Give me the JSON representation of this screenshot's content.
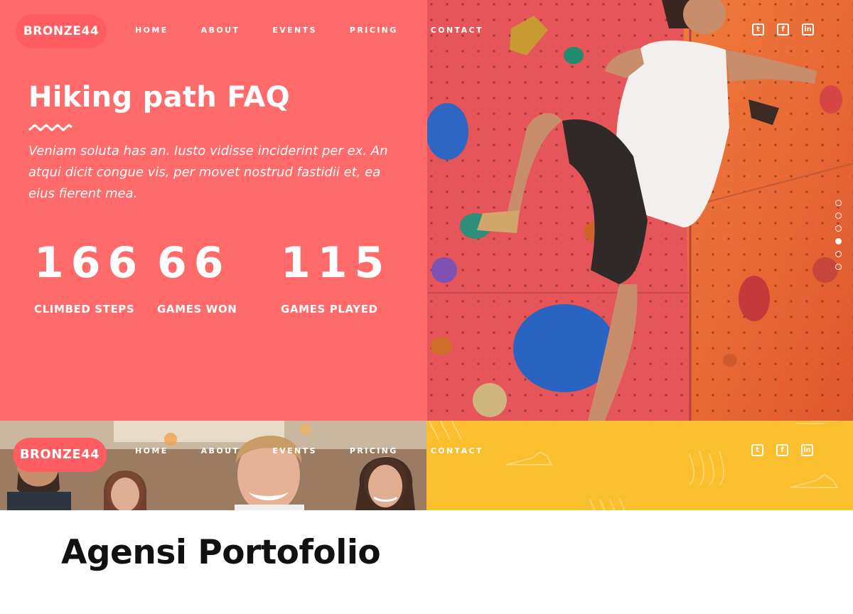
{
  "brand": {
    "logo_text": "BRONZE44"
  },
  "nav": {
    "items": [
      {
        "label": "HOME"
      },
      {
        "label": "ABOUT"
      },
      {
        "label": "EVENTS"
      },
      {
        "label": "PRICING"
      },
      {
        "label": "CONTACT"
      }
    ]
  },
  "social": {
    "items": [
      {
        "icon": "twitter-icon",
        "glyph": "t"
      },
      {
        "icon": "facebook-icon",
        "glyph": "f"
      },
      {
        "icon": "linkedin-icon",
        "glyph": "in"
      }
    ]
  },
  "hero": {
    "title": "Hiking path FAQ",
    "description": "Veniam soluta has an. Iusto vidisse inciderint per ex. An atqui dicit congue vis, per movet nostrud fastidii et, ea eius fierent mea.",
    "stats": [
      {
        "number": "166",
        "label": "CLIMBED STEPS"
      },
      {
        "number": "66",
        "label": "GAMES WON"
      },
      {
        "number": "115",
        "label": "GAMES PLAYED"
      }
    ],
    "slider": {
      "total_slides": 6,
      "active_index": 3
    }
  },
  "caption": {
    "title": "Agensi Portofolio"
  },
  "colors": {
    "coral": "#ff6b6b",
    "logo_coral": "#ff5d62",
    "yellow": "#fbbf2e",
    "white": "#ffffff",
    "text_dark": "#111111"
  }
}
